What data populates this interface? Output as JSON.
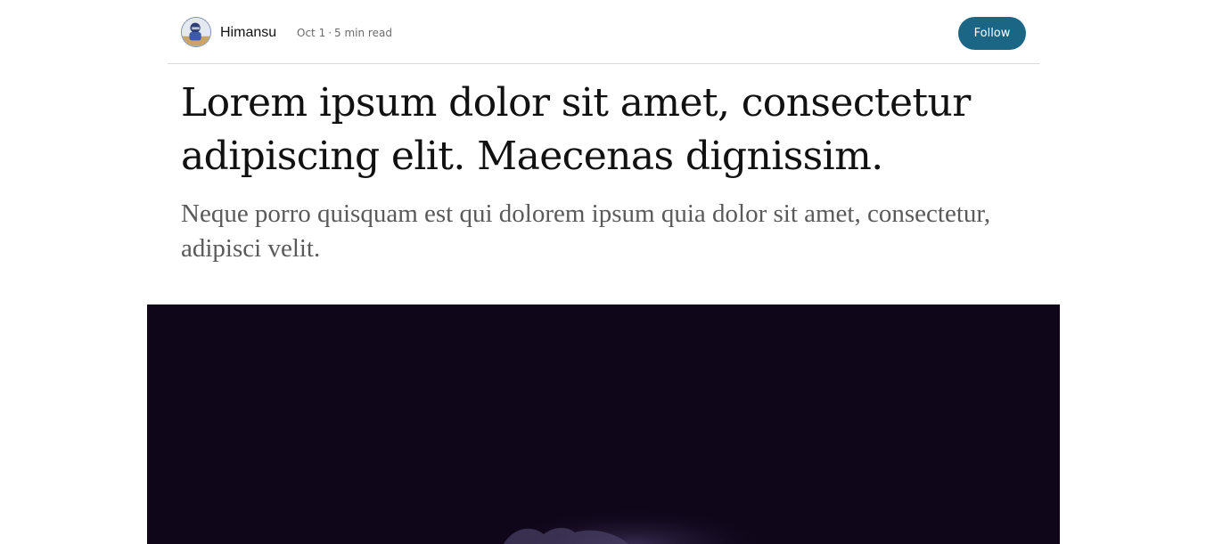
{
  "author": {
    "name": "Himansu",
    "date": "Oct 1",
    "separator": "·",
    "read_time": "5 min read",
    "avatar_icon": "user-avatar"
  },
  "actions": {
    "follow_label": "Follow"
  },
  "article": {
    "title": "Lorem ipsum dolor sit amet, consectetur adipiscing elit. Maecenas dignissim.",
    "subtitle": "Neque porro quisquam est qui dolorem ipsum quia dolor sit amet, consectetur, adipisci velit."
  },
  "colors": {
    "accent": "#1b6685",
    "hero_background": "#10061a",
    "title_text": "#111111",
    "subtitle_text": "#5a5a5a"
  }
}
